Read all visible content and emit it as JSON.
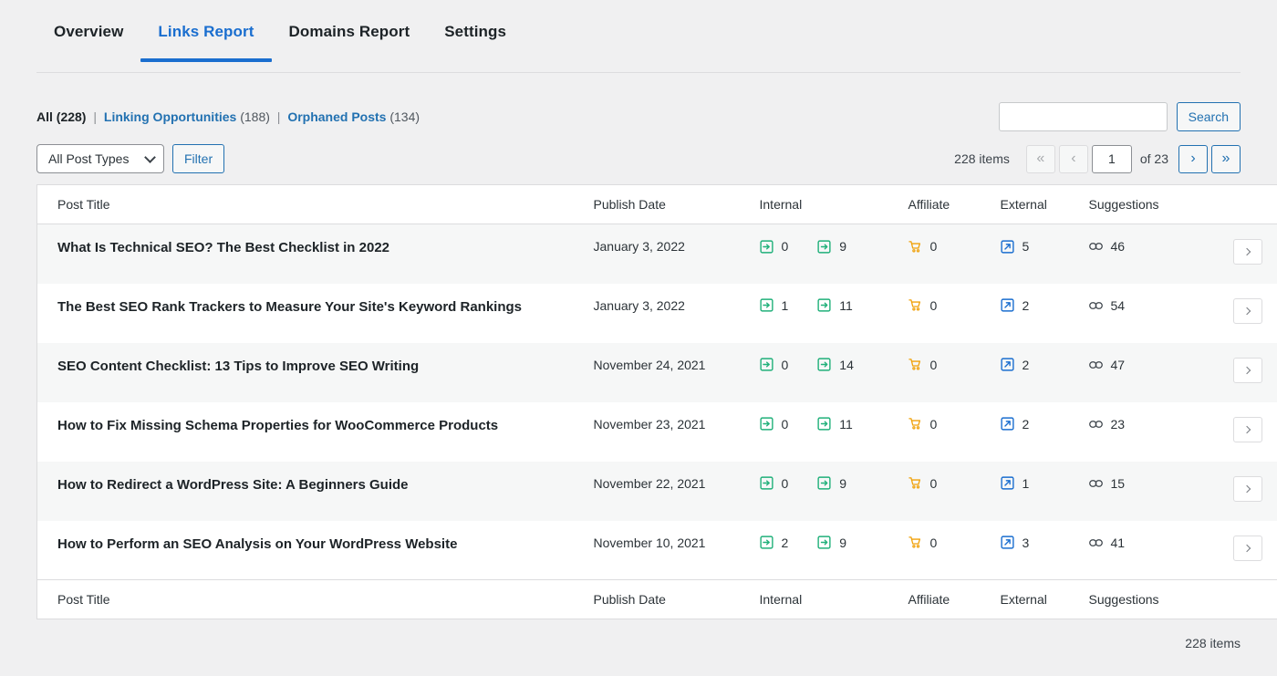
{
  "tabs": [
    {
      "label": "Overview",
      "active": false
    },
    {
      "label": "Links Report",
      "active": true
    },
    {
      "label": "Domains Report",
      "active": false
    },
    {
      "label": "Settings",
      "active": false
    }
  ],
  "views": {
    "all_label": "All",
    "all_count": "(228)",
    "sep": "|",
    "linking_label": "Linking Opportunities",
    "linking_count": "(188)",
    "orphaned_label": "Orphaned Posts",
    "orphaned_count": "(134)"
  },
  "search": {
    "value": "",
    "placeholder": "",
    "button_label": "Search"
  },
  "filters": {
    "post_type_selected": "All Post Types",
    "post_type_options": [
      "All Post Types"
    ],
    "filter_button_label": "Filter"
  },
  "pagination": {
    "items_label": "228 items",
    "first_label": "«",
    "prev_label": "‹",
    "current_page": "1",
    "of_label": "of 23",
    "next_label": "›",
    "last_label": "»",
    "first_enabled": false,
    "prev_enabled": false,
    "next_enabled": true,
    "last_enabled": true
  },
  "table": {
    "columns": {
      "title": "Post Title",
      "date": "Publish Date",
      "internal": "Internal",
      "affiliate": "Affiliate",
      "external": "External",
      "suggestions": "Suggestions"
    },
    "icons": {
      "inbound": "inbound-link-icon",
      "outbound": "outbound-link-icon",
      "affiliate": "shopping-cart-icon",
      "external": "external-link-icon",
      "suggestions": "chain-link-icon",
      "row_action": "chevron-right-icon"
    },
    "colors": {
      "internal": "#20b07a",
      "affiliate": "#f0a10a",
      "external": "#1a6ecf",
      "suggestions": "#3c434a",
      "accent": "#2271b1",
      "active_tab": "#1a6ecf"
    },
    "rows": [
      {
        "title": "What Is Technical SEO? The Best Checklist in 2022",
        "date": "January 3, 2022",
        "inbound": "0",
        "outbound": "9",
        "affiliate": "0",
        "external": "5",
        "suggestions": "46"
      },
      {
        "title": "The Best SEO Rank Trackers to Measure Your Site's Keyword Rankings",
        "date": "January 3, 2022",
        "inbound": "1",
        "outbound": "11",
        "affiliate": "0",
        "external": "2",
        "suggestions": "54"
      },
      {
        "title": "SEO Content Checklist: 13 Tips to Improve SEO Writing",
        "date": "November 24, 2021",
        "inbound": "0",
        "outbound": "14",
        "affiliate": "0",
        "external": "2",
        "suggestions": "47"
      },
      {
        "title": "How to Fix Missing Schema Properties for WooCommerce Products",
        "date": "November 23, 2021",
        "inbound": "0",
        "outbound": "11",
        "affiliate": "0",
        "external": "2",
        "suggestions": "23"
      },
      {
        "title": "How to Redirect a WordPress Site: A Beginners Guide",
        "date": "November 22, 2021",
        "inbound": "0",
        "outbound": "9",
        "affiliate": "0",
        "external": "1",
        "suggestions": "15"
      },
      {
        "title": "How to Perform an SEO Analysis on Your WordPress Website",
        "date": "November 10, 2021",
        "inbound": "2",
        "outbound": "9",
        "affiliate": "0",
        "external": "3",
        "suggestions": "41"
      }
    ]
  },
  "footer": {
    "items_label": "228 items"
  }
}
